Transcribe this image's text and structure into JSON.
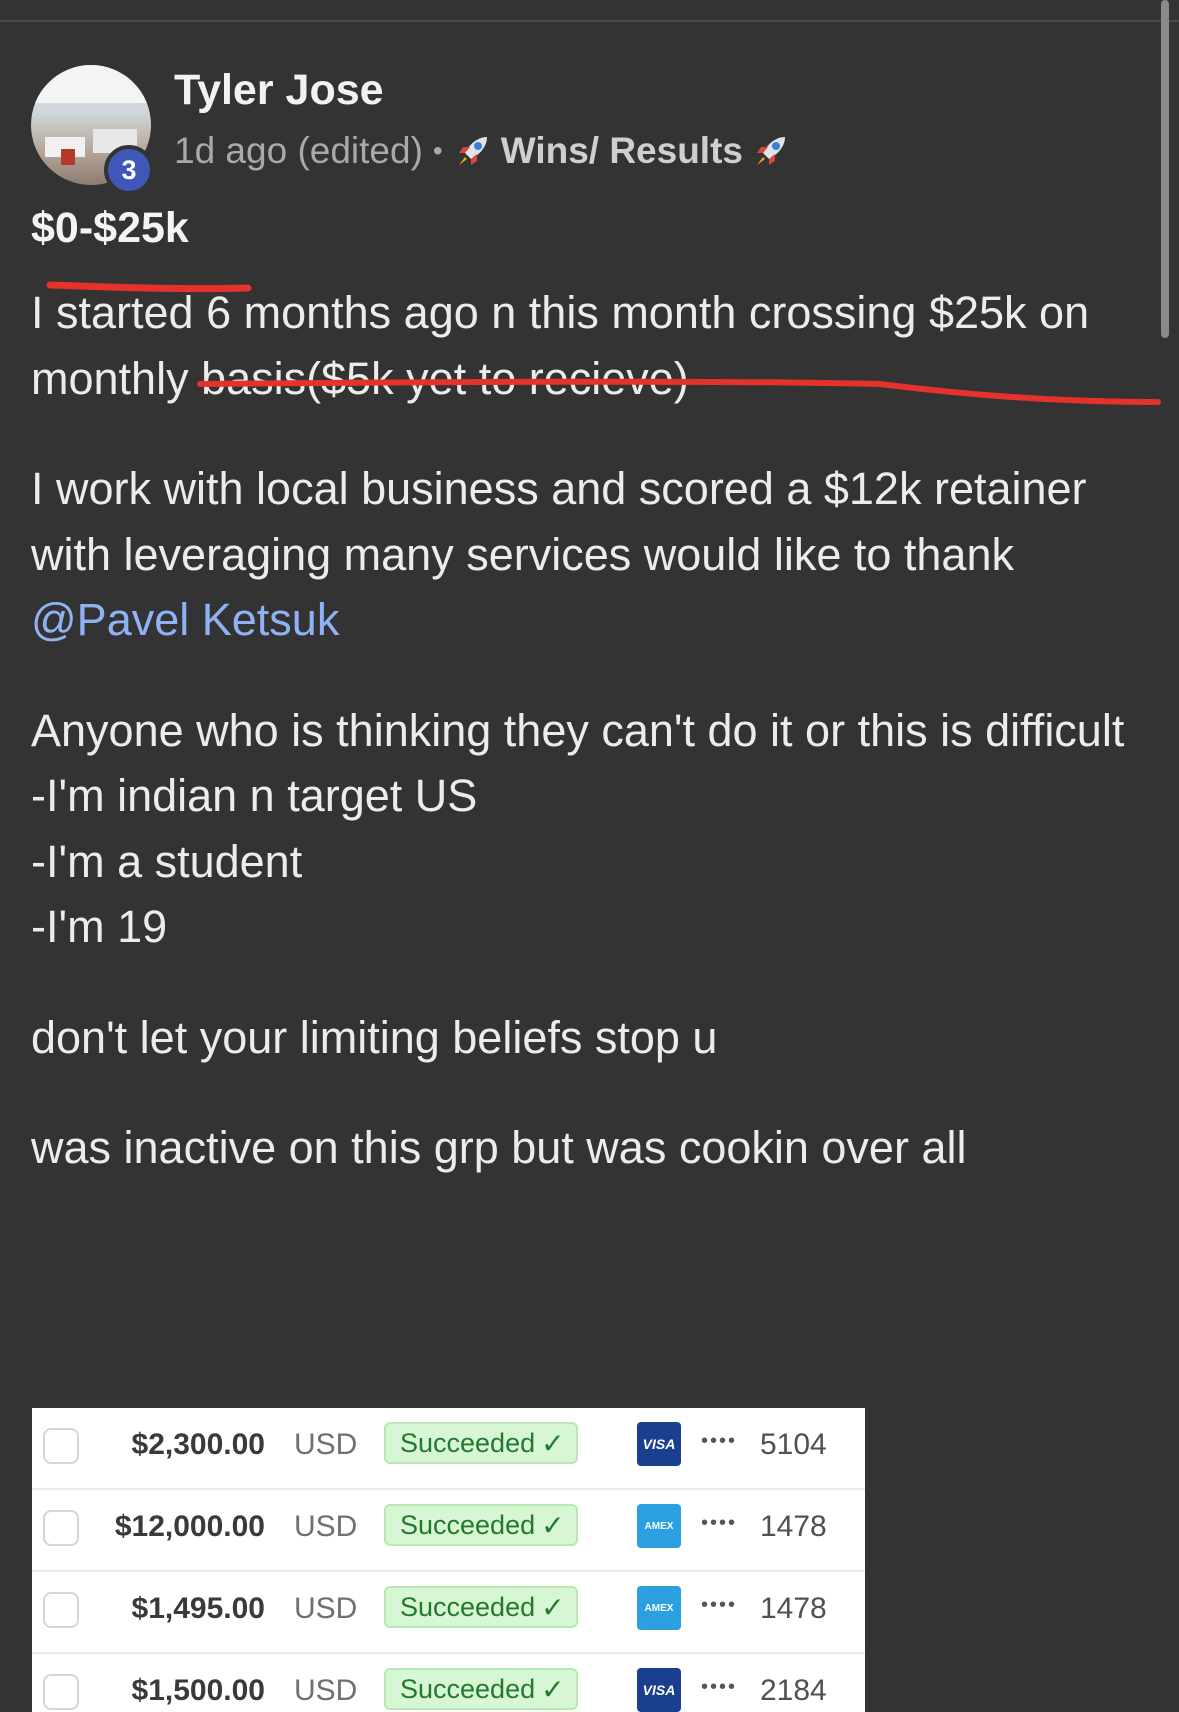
{
  "post": {
    "author": "Tyler Jose",
    "level": "3",
    "time": "1d ago (edited)",
    "separator": "•",
    "category": "Wins/ Results",
    "title": "$0-$25k",
    "paragraphs": [
      "I started 6 months ago n this month crossing $25k on monthly basis($5k yet to recieve)",
      "I work with local business and scored a $12k retainer with leveraging many services would like to thank",
      "Anyone who is thinking they can't do it or this is difficult",
      "-I'm indian n target US",
      "-I'm a student",
      "-I'm 19",
      "don't let your limiting beliefs stop u",
      "was inactive on this grp but was cookin over all"
    ],
    "mention": "@Pavel Ketsuk",
    "accent_mention": "#8fb2f5",
    "annotation_color": "#e5322b"
  },
  "payments": {
    "rows": [
      {
        "amount": "$2,300.00",
        "currency": "USD",
        "status": "Succeeded",
        "brand": "VISA",
        "brand_type": "visa",
        "dots": "••••",
        "last4": "5104"
      },
      {
        "amount": "$12,000.00",
        "currency": "USD",
        "status": "Succeeded",
        "brand": "AMEX",
        "brand_type": "amex",
        "dots": "••••",
        "last4": "1478"
      },
      {
        "amount": "$1,495.00",
        "currency": "USD",
        "status": "Succeeded",
        "brand": "AMEX",
        "brand_type": "amex",
        "dots": "••••",
        "last4": "1478"
      },
      {
        "amount": "$1,500.00",
        "currency": "USD",
        "status": "Succeeded",
        "brand": "VISA",
        "brand_type": "visa",
        "dots": "••••",
        "last4": "2184"
      }
    ]
  }
}
